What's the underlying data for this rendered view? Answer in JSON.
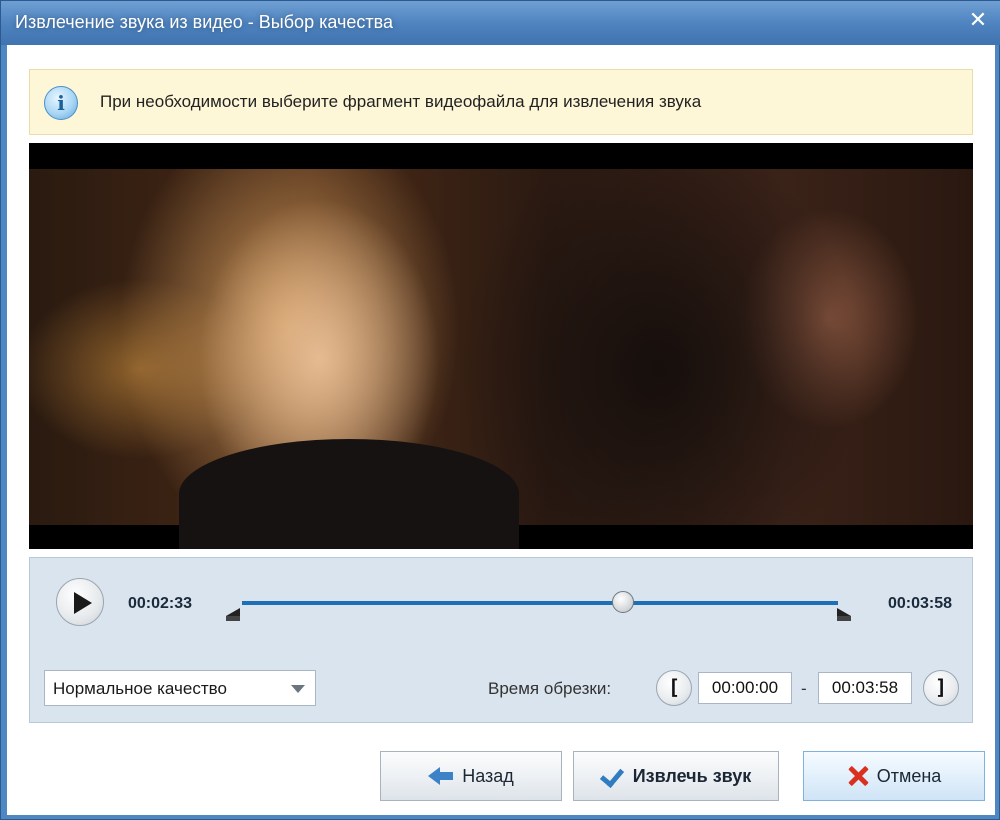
{
  "window": {
    "title": "Извлечение звука из видео - Выбор качества",
    "close_icon": "close-icon"
  },
  "info": {
    "icon": "info-icon",
    "text": "При необходимости выберите фрагмент видеофайла для извлечения звука"
  },
  "player": {
    "current_time": "00:02:33",
    "end_time": "00:03:58",
    "position_fraction": 0.64,
    "play_icon": "play-icon"
  },
  "quality": {
    "selected": "Нормальное качество"
  },
  "trim": {
    "label": "Время обрезки:",
    "start_bracket": "[",
    "end_bracket": "]",
    "start": "00:00:00",
    "separator": "-",
    "end": "00:03:58"
  },
  "buttons": {
    "back": "Назад",
    "extract": "Извлечь звук",
    "cancel": "Отмена"
  },
  "colors": {
    "titlebar": "#4f87c2",
    "track": "#1f6fb5",
    "cancel_icon": "#d9301f"
  }
}
